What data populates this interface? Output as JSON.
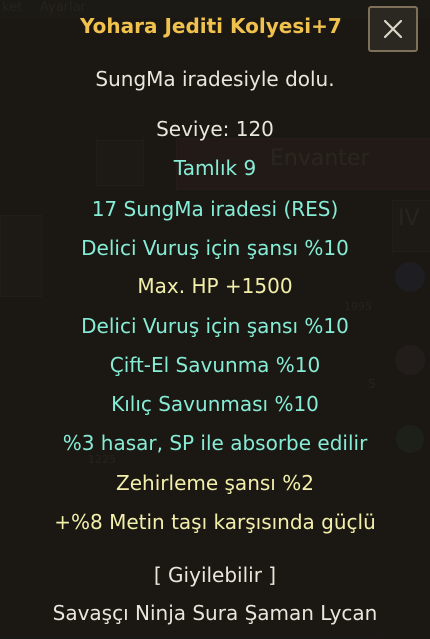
{
  "background": {
    "tabs": [
      "ket",
      "Ayarlar"
    ],
    "window_title": "Envanter",
    "roman_numeral": "IV",
    "counts": [
      "1995",
      "1225",
      "5"
    ]
  },
  "item": {
    "name": "Yohara Jediti Kolyesi+7",
    "description": "SungMa iradesiyle dolu.",
    "level": "Seviye: 120",
    "completeness": "Tamlık 9",
    "sungma": "17 SungMa iradesi (RES)",
    "attributes": [
      "Delici Vuruş için şansı %10",
      "Max. HP +1500",
      "Delici Vuruş için şansı %10",
      "Çift-El Savunma %10",
      "Kılıç Savunması %10",
      "%3 hasar, SP ile absorbe edilir",
      "Zehirleme şansı %2",
      "+%8 Metin taşı karşısında güçlü"
    ],
    "wearable": "[ Giyilebilir ]",
    "classes": "Savaşçı Ninja Sura Şaman Lycan"
  },
  "colors": {
    "title": "#f0c24d",
    "white": "#eae6dc",
    "teal": "#86ecd5",
    "yellow": "#f2efaa"
  },
  "icons": {
    "close": "close-icon"
  }
}
